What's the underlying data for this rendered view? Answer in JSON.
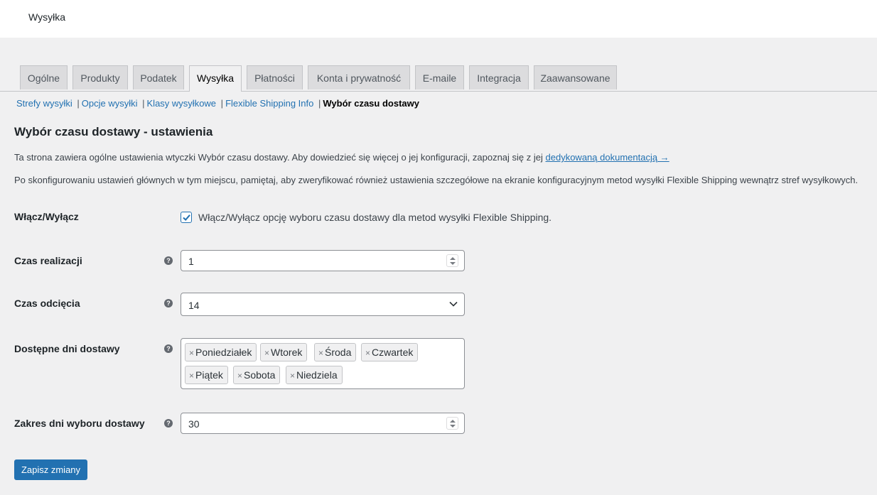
{
  "header": {
    "title": "Wysyłka"
  },
  "tabs": [
    {
      "label": "Ogólne"
    },
    {
      "label": "Produkty"
    },
    {
      "label": "Podatek"
    },
    {
      "label": "Wysyłka",
      "active": true
    },
    {
      "label": "Płatności"
    },
    {
      "label": "Konta i prywatność"
    },
    {
      "label": "E-maile"
    },
    {
      "label": "Integracja"
    },
    {
      "label": "Zaawansowane"
    }
  ],
  "subnav": {
    "items": [
      "Strefy wysyłki",
      "Opcje wysyłki",
      "Klasy wysyłkowe",
      "Flexible Shipping Info"
    ],
    "separator": "|",
    "current": "Wybór czasu dostawy"
  },
  "section": {
    "title": "Wybór czasu dostawy - ustawienia",
    "desc1_text": "Ta strona zawiera ogólne ustawienia wtyczki Wybór czasu dostawy. Aby dowiedzieć się więcej o jej konfiguracji, zapoznaj się z jej",
    "desc1_link": "dedykowaną dokumentacją →",
    "desc2_text": "Po skonfigurowaniu ustawień głównych w tym miejscu, pamiętaj, aby zweryfikować również ustawienia szczegółowe na ekranie konfiguracyjnym metod wysyłki Flexible Shipping wewnątrz stref wysyłkowych."
  },
  "fields": {
    "enable": {
      "label": "Włącz/Wyłącz",
      "checked": true,
      "checkbox_label": "Włącz/Wyłącz opcję wyboru czasu dostawy dla metod wysyłki Flexible Shipping."
    },
    "lead_time": {
      "label": "Czas realizacji",
      "value": "1"
    },
    "cutoff_time": {
      "label": "Czas odcięcia",
      "value": "14"
    },
    "delivery_days": {
      "label": "Dostępne dni dostawy",
      "chips": [
        "Poniedziałek",
        "Wtorek",
        "Środa",
        "Czwartek",
        "Piątek",
        "Sobota",
        "Niedziela"
      ]
    },
    "range": {
      "label": "Zakres dni wyboru dostawy",
      "value": "30"
    }
  },
  "help_icon": "question-circle-icon",
  "remove_icon": "×",
  "save_button": "Zapisz zmiany",
  "colors": {
    "primary": "#2271b1",
    "link": "#2271b1",
    "background": "#f0f0f1"
  }
}
